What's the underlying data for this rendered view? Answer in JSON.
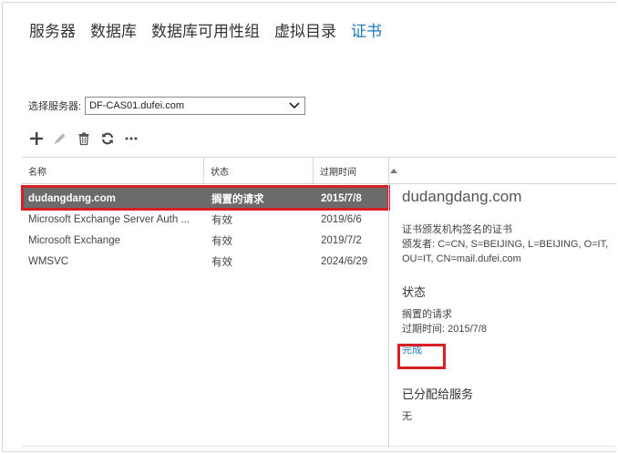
{
  "tabs": [
    {
      "label": "服务器",
      "active": false
    },
    {
      "label": "数据库",
      "active": false
    },
    {
      "label": "数据库可用性组",
      "active": false
    },
    {
      "label": "虚拟目录",
      "active": false
    },
    {
      "label": "证书",
      "active": true
    }
  ],
  "server": {
    "label": "选择服务器:",
    "value": "DF-CAS01.dufei.com"
  },
  "toolbar": {
    "icons": [
      "add-icon",
      "edit-icon",
      "delete-icon",
      "refresh-icon",
      "more-icon"
    ]
  },
  "table": {
    "columns": [
      "名称",
      "状态",
      "过期时间"
    ],
    "rows": [
      {
        "name": "dudangdang.com",
        "status": "搁置的请求",
        "expires": "2015/7/8",
        "selected": true
      },
      {
        "name": "Microsoft Exchange Server Auth ...",
        "status": "有效",
        "expires": "2019/6/6"
      },
      {
        "name": "Microsoft Exchange",
        "status": "有效",
        "expires": "2019/7/2"
      },
      {
        "name": "WMSVC",
        "status": "有效",
        "expires": "2024/6/29"
      }
    ]
  },
  "details": {
    "title": "dudangdang.com",
    "type": "证书颁发机构签名的证书",
    "issuer_line1": "颁发者: C=CN, S=BEIJING, L=BEIJING, O=IT,",
    "issuer_line2": "OU=IT, CN=mail.dufei.com",
    "status_heading": "状态",
    "status_value": "搁置的请求",
    "expires": "过期时间: 2015/7/8",
    "complete_link": "完成",
    "services_heading": "已分配给服务",
    "services_value": "无"
  },
  "colors": {
    "accent": "#1e7ab8",
    "selected_row": "#6b6b6b",
    "highlight_box": "#d61f26"
  }
}
